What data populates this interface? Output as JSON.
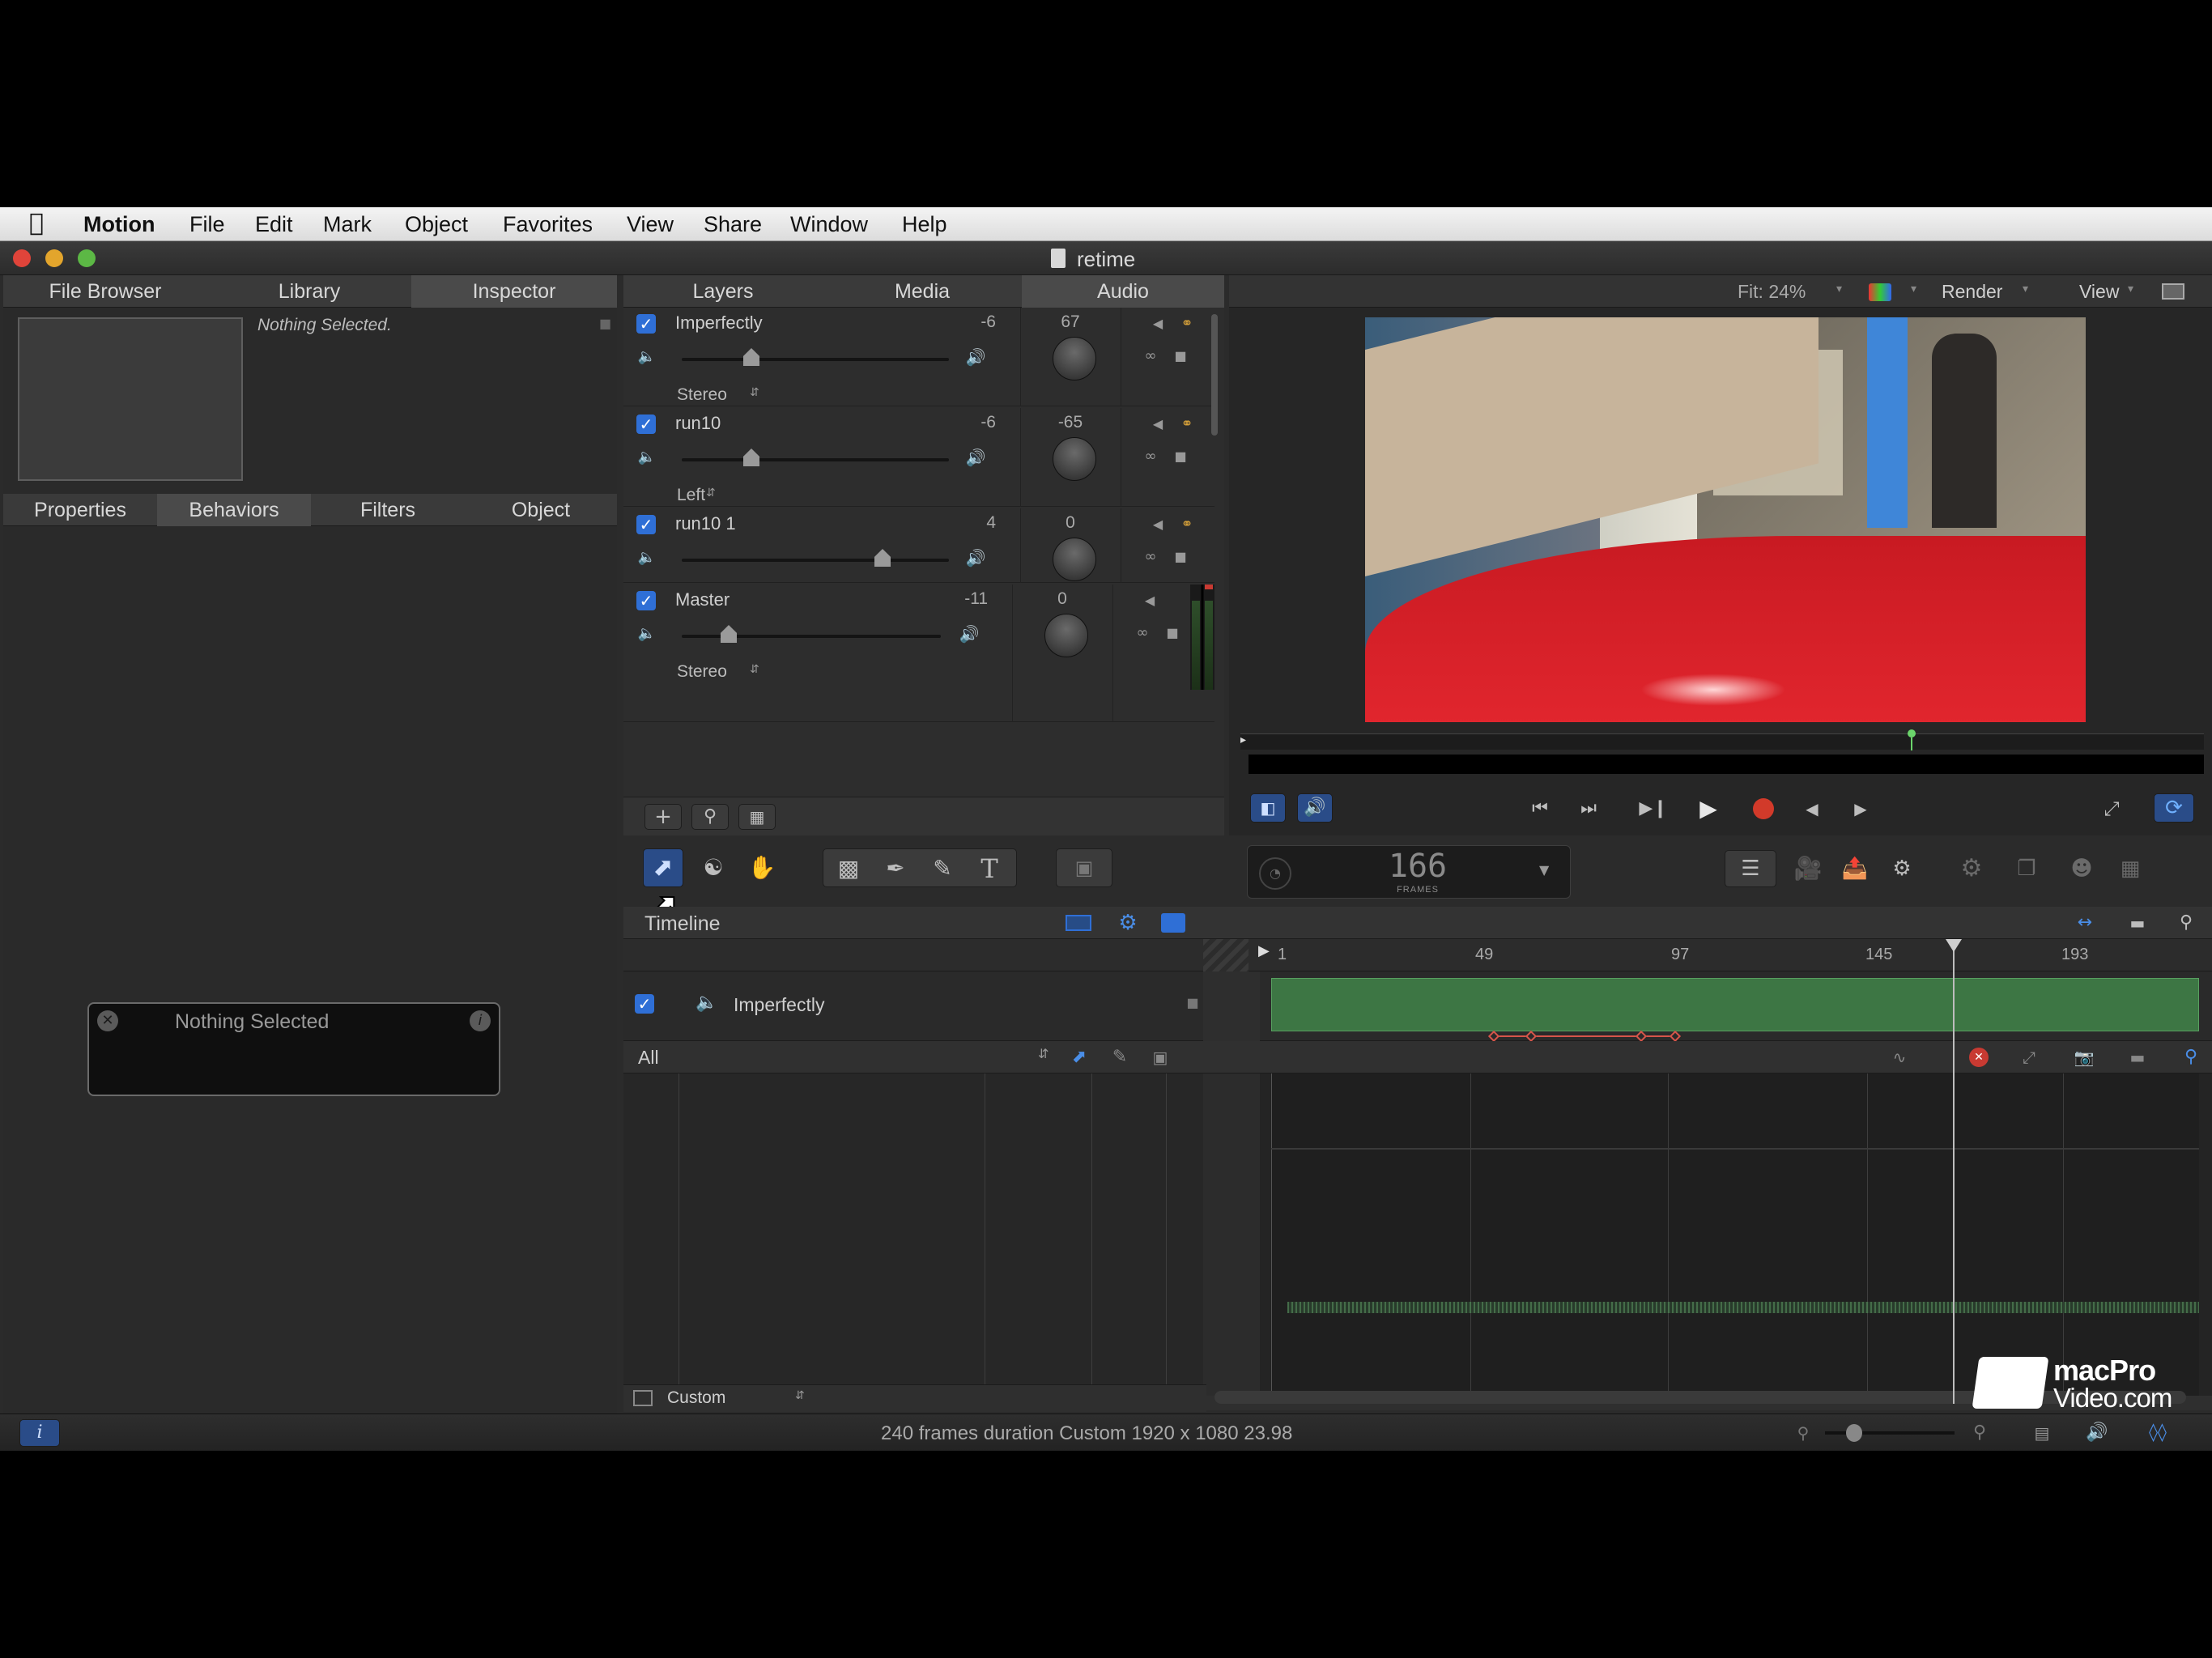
{
  "menubar": {
    "app": "Motion",
    "items": [
      "File",
      "Edit",
      "Mark",
      "Object",
      "Favorites",
      "View",
      "Share",
      "Window",
      "Help"
    ]
  },
  "window": {
    "title": "retime"
  },
  "left_panel": {
    "tabs": [
      "File Browser",
      "Library",
      "Inspector"
    ],
    "selected_tab": "Inspector",
    "preview_text": "Nothing Selected.",
    "sub_tabs": [
      "Properties",
      "Behaviors",
      "Filters",
      "Object"
    ],
    "selected_sub_tab": "Behaviors",
    "hud": {
      "title": "Nothing Selected"
    }
  },
  "audio_panel": {
    "tabs": [
      "Layers",
      "Media",
      "Audio"
    ],
    "selected_tab": "Audio",
    "tracks": [
      {
        "name": "Imperfectly",
        "level": "-6",
        "pan": "67",
        "mode": "Stereo",
        "slider": 0.26
      },
      {
        "name": "run10",
        "level": "-6",
        "pan": "-65",
        "mode": "Left",
        "slider": 0.26
      },
      {
        "name": "run10 1",
        "level": "4",
        "pan": "0",
        "mode": "",
        "slider": 0.75
      }
    ],
    "master": {
      "name": "Master",
      "level": "-11",
      "pan": "0",
      "mode": "Stereo",
      "slider": 0.18
    }
  },
  "canvas_toolbar": {
    "fit": "Fit: 24%",
    "render": "Render",
    "view": "View"
  },
  "timecode": {
    "value": "166",
    "unit": "FRAMES"
  },
  "timeline": {
    "title": "Timeline",
    "ruler": [
      "1",
      "49",
      "97",
      "145",
      "193"
    ],
    "track_name": "Imperfectly",
    "filter": "All",
    "footer_preset": "Custom"
  },
  "statusbar": {
    "text": "240 frames duration Custom 1920 x 1080 23.98"
  },
  "watermark": {
    "line1": "macPro",
    "line2": "Video.com"
  },
  "colors": {
    "accent": "#2f6fd6",
    "clip_green": "#3f7a45",
    "record_red": "#d23a2a",
    "video_red": "#d8202a"
  },
  "icons": {
    "apple": "apple-icon",
    "speaker": "speaker-icon",
    "play": "play-icon",
    "record": "record-icon",
    "loop": "loop-icon",
    "gear": "gear-icon",
    "info": "info-icon",
    "close": "close-icon",
    "link": "link-icon",
    "lock": "lock-icon",
    "headphones": "headphones-icon"
  }
}
